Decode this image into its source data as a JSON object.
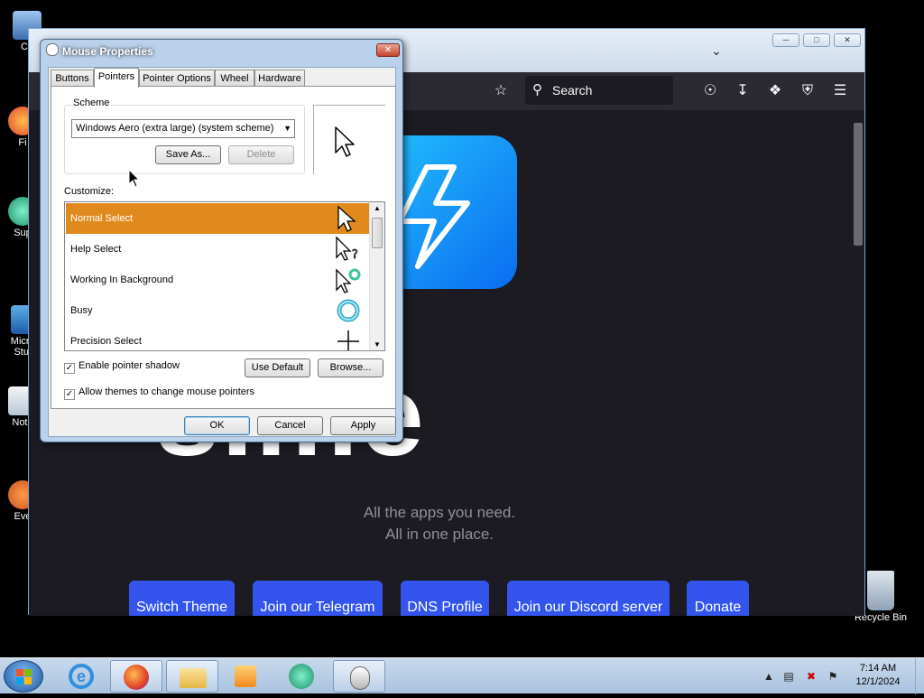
{
  "desktop": {
    "icons": [
      {
        "label": "Co"
      },
      {
        "label": "Fi"
      },
      {
        "label": "Sup"
      },
      {
        "label": "Micros"
      },
      {
        "label": "Studi"
      },
      {
        "label": "Note"
      },
      {
        "label": "Eve"
      }
    ],
    "recycle_bin_label": "Recycle Bin"
  },
  "browser": {
    "search_placeholder": "Search",
    "hero_text": "s.me",
    "tagline_line1": "All the apps you need.",
    "tagline_line2": "All in one place.",
    "buttons": [
      "Switch Theme",
      "Join our Telegram",
      "DNS Profile",
      "Join our Discord server",
      "Donate"
    ],
    "colors": {
      "background": "#1c1b22",
      "accent": "#3355ee",
      "logo": "#22c2ff"
    }
  },
  "dialog": {
    "title": "Mouse Properties",
    "tabs": [
      "Buttons",
      "Pointers",
      "Pointer Options",
      "Wheel",
      "Hardware"
    ],
    "active_tab": "Pointers",
    "scheme_label": "Scheme",
    "scheme_value": "Windows Aero (extra large) (system scheme)",
    "save_as_label": "Save As...",
    "delete_label": "Delete",
    "customize_label": "Customize:",
    "cursors": [
      {
        "name": "Normal Select",
        "selected": true,
        "icon": "arrow-icon"
      },
      {
        "name": "Help Select",
        "selected": false,
        "icon": "help-arrow-icon"
      },
      {
        "name": "Working In Background",
        "selected": false,
        "icon": "working-arrow-icon"
      },
      {
        "name": "Busy",
        "selected": false,
        "icon": "busy-ring-icon"
      },
      {
        "name": "Precision Select",
        "selected": false,
        "icon": "crosshair-icon"
      }
    ],
    "enable_shadow_label": "Enable pointer shadow",
    "enable_shadow_checked": true,
    "allow_themes_label": "Allow themes to change mouse pointers",
    "allow_themes_checked": true,
    "use_default_label": "Use Default",
    "browse_label": "Browse...",
    "ok_label": "OK",
    "cancel_label": "Cancel",
    "apply_label": "Apply",
    "selection_color": "#e08a1e"
  },
  "taskbar": {
    "time": "7:14 AM",
    "date": "12/1/2024"
  }
}
